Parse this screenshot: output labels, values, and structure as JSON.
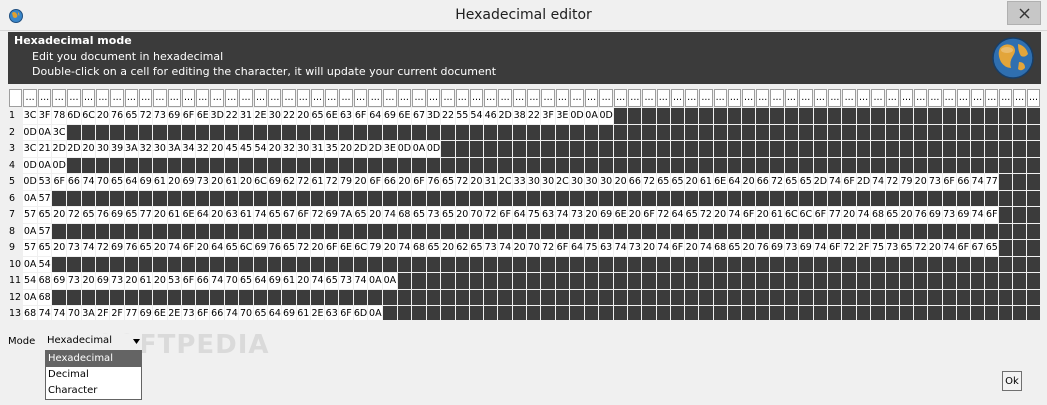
{
  "window": {
    "title": "Hexadecimal editor"
  },
  "header": {
    "title": "Hexadecimal mode",
    "line1": "Edit you document in hexadecimal",
    "line2": "Double-click on a cell for editing the character, it will update your current document"
  },
  "grid": {
    "column_header_label": "...",
    "column_count": 71,
    "rows": [
      {
        "number": "1",
        "cells": [
          "3C",
          "3F",
          "78",
          "6D",
          "6C",
          "20",
          "76",
          "65",
          "72",
          "73",
          "69",
          "6F",
          "6E",
          "3D",
          "22",
          "31",
          "2E",
          "30",
          "22",
          "20",
          "65",
          "6E",
          "63",
          "6F",
          "64",
          "69",
          "6E",
          "67",
          "3D",
          "22",
          "55",
          "54",
          "46",
          "2D",
          "38",
          "22",
          "3F",
          "3E",
          "0D",
          "0A",
          "0D"
        ]
      },
      {
        "number": "2",
        "cells": [
          "0D",
          "0A",
          "3C"
        ]
      },
      {
        "number": "3",
        "cells": [
          "3C",
          "21",
          "2D",
          "2D",
          "20",
          "30",
          "39",
          "3A",
          "32",
          "30",
          "3A",
          "34",
          "32",
          "20",
          "45",
          "45",
          "54",
          "20",
          "32",
          "30",
          "31",
          "35",
          "20",
          "2D",
          "2D",
          "3E",
          "0D",
          "0A",
          "0D"
        ]
      },
      {
        "number": "4",
        "cells": [
          "0D",
          "0A",
          "0D"
        ]
      },
      {
        "number": "5",
        "cells": [
          "0D",
          "53",
          "6F",
          "66",
          "74",
          "70",
          "65",
          "64",
          "69",
          "61",
          "20",
          "69",
          "73",
          "20",
          "61",
          "20",
          "6C",
          "69",
          "62",
          "72",
          "61",
          "72",
          "79",
          "20",
          "6F",
          "66",
          "20",
          "6F",
          "76",
          "65",
          "72",
          "20",
          "31",
          "2C",
          "33",
          "30",
          "30",
          "2C",
          "30",
          "30",
          "30",
          "20",
          "66",
          "72",
          "65",
          "65",
          "20",
          "61",
          "6E",
          "64",
          "20",
          "66",
          "72",
          "65",
          "65",
          "2D",
          "74",
          "6F",
          "2D",
          "74",
          "72",
          "79",
          "20",
          "73",
          "6F",
          "66",
          "74",
          "77"
        ]
      },
      {
        "number": "6",
        "cells": [
          "0A",
          "57"
        ]
      },
      {
        "number": "7",
        "cells": [
          "57",
          "65",
          "20",
          "72",
          "65",
          "76",
          "69",
          "65",
          "77",
          "20",
          "61",
          "6E",
          "64",
          "20",
          "63",
          "61",
          "74",
          "65",
          "67",
          "6F",
          "72",
          "69",
          "7A",
          "65",
          "20",
          "74",
          "68",
          "65",
          "73",
          "65",
          "20",
          "70",
          "72",
          "6F",
          "64",
          "75",
          "63",
          "74",
          "73",
          "20",
          "69",
          "6E",
          "20",
          "6F",
          "72",
          "64",
          "65",
          "72",
          "20",
          "74",
          "6F",
          "20",
          "61",
          "6C",
          "6C",
          "6F",
          "77",
          "20",
          "74",
          "68",
          "65",
          "20",
          "76",
          "69",
          "73",
          "69",
          "74",
          "6F"
        ]
      },
      {
        "number": "8",
        "cells": [
          "0A",
          "57"
        ]
      },
      {
        "number": "9",
        "cells": [
          "57",
          "65",
          "20",
          "73",
          "74",
          "72",
          "69",
          "76",
          "65",
          "20",
          "74",
          "6F",
          "20",
          "64",
          "65",
          "6C",
          "69",
          "76",
          "65",
          "72",
          "20",
          "6F",
          "6E",
          "6C",
          "79",
          "20",
          "74",
          "68",
          "65",
          "20",
          "62",
          "65",
          "73",
          "74",
          "20",
          "70",
          "72",
          "6F",
          "64",
          "75",
          "63",
          "74",
          "73",
          "20",
          "74",
          "6F",
          "20",
          "74",
          "68",
          "65",
          "20",
          "76",
          "69",
          "73",
          "69",
          "74",
          "6F",
          "72",
          "2F",
          "75",
          "73",
          "65",
          "72",
          "20",
          "74",
          "6F",
          "67",
          "65"
        ]
      },
      {
        "number": "10",
        "cells": [
          "0A",
          "54"
        ]
      },
      {
        "number": "11",
        "cells": [
          "54",
          "68",
          "69",
          "73",
          "20",
          "69",
          "73",
          "20",
          "61",
          "20",
          "53",
          "6F",
          "66",
          "74",
          "70",
          "65",
          "64",
          "69",
          "61",
          "20",
          "74",
          "65",
          "73",
          "74",
          "0A",
          "0A"
        ]
      },
      {
        "number": "12",
        "cells": [
          "0A",
          "68"
        ]
      },
      {
        "number": "13",
        "cells": [
          "68",
          "74",
          "74",
          "70",
          "3A",
          "2F",
          "2F",
          "77",
          "69",
          "6E",
          "2E",
          "73",
          "6F",
          "66",
          "74",
          "70",
          "65",
          "64",
          "69",
          "61",
          "2E",
          "63",
          "6F",
          "6D",
          "0A"
        ]
      }
    ]
  },
  "mode": {
    "label": "Mode",
    "selected": "Hexadecimal",
    "options": [
      "Hexadecimal",
      "Decimal",
      "Character"
    ]
  },
  "watermark": "SOFTPEDIA",
  "buttons": {
    "ok": "Ok"
  },
  "colors": {
    "header_bg": "#3b3b3b",
    "cell_bg": "#3b3b3b",
    "selected_option_bg": "#646464"
  }
}
